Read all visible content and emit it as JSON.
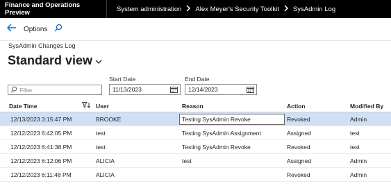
{
  "topbar": {
    "app_title": "Finance and Operations Preview",
    "breadcrumbs": [
      "System administration",
      "Alex Meyer's Security Toolkit",
      "SysAdmin Log"
    ]
  },
  "actionbar": {
    "back_icon": "back-arrow-icon",
    "options_label": "Options",
    "search_icon": "search-icon"
  },
  "page": {
    "caption": "SysAdmin Changes Log",
    "view_title": "Standard view"
  },
  "filters": {
    "filter_placeholder": "Filter",
    "start_date_label": "Start Date",
    "start_date_value": "11/13/2023",
    "end_date_label": "End Date",
    "end_date_value": "12/14/2023"
  },
  "grid": {
    "columns": [
      "Date Time",
      "User",
      "Reason",
      "Action",
      "Modified By"
    ],
    "rows": [
      {
        "datetime": "12/13/2023 3:15:47 PM",
        "user": "BROOKE",
        "reason": "Testing SysAdmin Revoke",
        "action": "Revoked",
        "modified_by": "Admin",
        "selected": true
      },
      {
        "datetime": "12/12/2023 6:42:05 PM",
        "user": "test",
        "reason": "Testing SysAdmin Assignment",
        "action": "Assigned",
        "modified_by": "test",
        "selected": false
      },
      {
        "datetime": "12/12/2023 6:41:38 PM",
        "user": "test",
        "reason": "Testing SysAdmin Revoke",
        "action": "Revoked",
        "modified_by": "test",
        "selected": false
      },
      {
        "datetime": "12/12/2023 6:12:06 PM",
        "user": "ALICIA",
        "reason": "test",
        "action": "Assigned",
        "modified_by": "Admin",
        "selected": false
      },
      {
        "datetime": "12/12/2023 6:11:48 PM",
        "user": "ALICIA",
        "reason": "",
        "action": "Revoked",
        "modified_by": "Admin",
        "selected": false
      }
    ]
  },
  "colors": {
    "topbar_bg": "#000000",
    "accent": "#0f6cbd",
    "selected_row": "#cfe0f5"
  }
}
